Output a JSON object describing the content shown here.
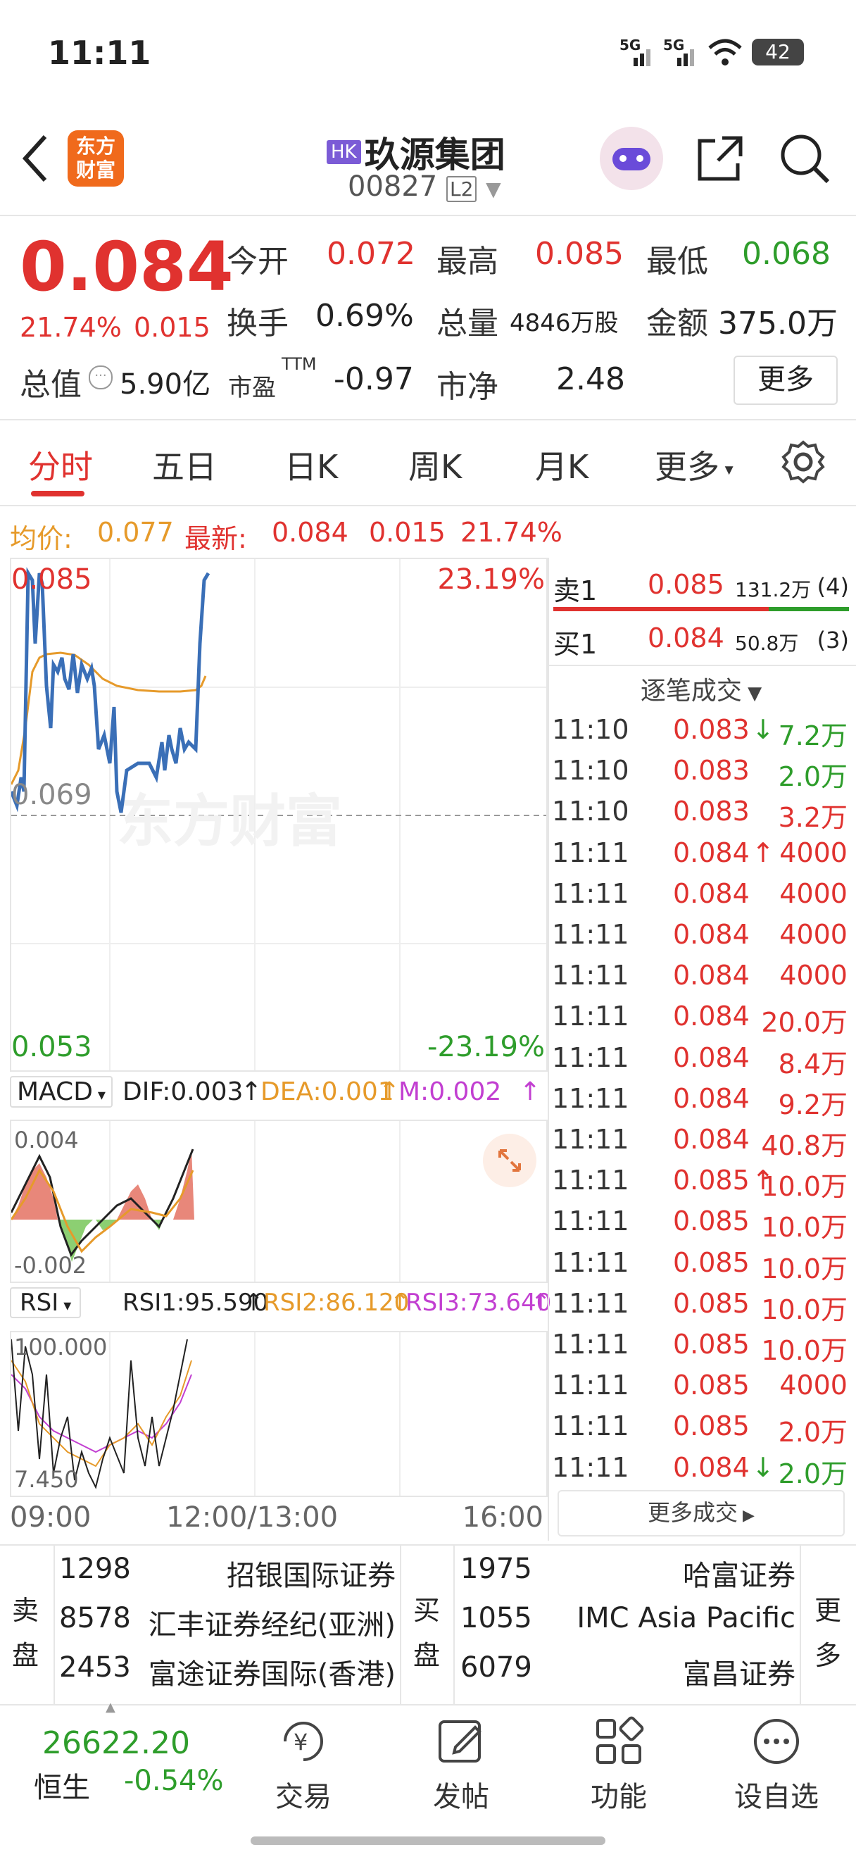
{
  "status_bar": {
    "time": "11:11",
    "signal1": "5G",
    "signal2": "5G",
    "battery": "42"
  },
  "header": {
    "back_icon": "chevron-left-icon",
    "app_logo_line1": "东方",
    "app_logo_line2": "财富",
    "market_badge": "HK",
    "stock_name": "玖源集团",
    "stock_code": "00827",
    "level_badge": "L2"
  },
  "quote": {
    "price": "0.084",
    "change_pct": "21.74%",
    "change_amt": "0.015",
    "open_label": "今开",
    "open": "0.072",
    "high_label": "最高",
    "high": "0.085",
    "low_label": "最低",
    "low": "0.068",
    "turnover_label": "换手",
    "turnover": "0.69%",
    "volume_label": "总量",
    "volume": "4846万股",
    "amount_label": "金额",
    "amount": "375.0万",
    "mktcap_label": "总值",
    "mktcap": "5.90亿",
    "pe_label": "市盈",
    "pe_sup": "TTM",
    "pe": "-0.97",
    "pb_label": "市净",
    "pb": "2.48",
    "more_button": "更多"
  },
  "tabs": [
    "分时",
    "五日",
    "日K",
    "周K",
    "月K",
    "更多"
  ],
  "avg_line": {
    "avg_label": "均价:",
    "avg": "0.077",
    "latest_label": "最新:",
    "latest": "0.084",
    "chg": "0.015",
    "pct": "21.74%"
  },
  "chart": {
    "y_top": "0.085",
    "y_mid": "0.069",
    "y_bottom": "0.053",
    "pct_top": "23.19%",
    "pct_bottom": "-23.19%",
    "watermark": "东方财富",
    "x_labels": [
      "09:00",
      "12:00/13:00",
      "16:00"
    ]
  },
  "macd": {
    "selector": "MACD",
    "dif": "DIF:0.003",
    "dea": "DEA:0.001",
    "m": "M:0.002",
    "top": "0.004",
    "bottom": "-0.002"
  },
  "rsi": {
    "selector": "RSI",
    "rsi1": "RSI1:95.590",
    "rsi2": "RSI2:86.120",
    "rsi3": "RSI3:73.640",
    "top": "100.000",
    "bottom": "7.450"
  },
  "order_book": {
    "sell_label": "卖1",
    "sell_price": "0.085",
    "sell_vol": "131.2万",
    "sell_count": "(4)",
    "buy_label": "买1",
    "buy_price": "0.084",
    "buy_vol": "50.8万",
    "buy_count": "(3)"
  },
  "ticks_title": "逐笔成交",
  "ticks": [
    {
      "time": "11:10",
      "price": "0.083",
      "arrow": "↓",
      "vol": "7.2万",
      "dir": "down"
    },
    {
      "time": "11:10",
      "price": "0.083",
      "arrow": "",
      "vol": "2.0万",
      "dir": "down"
    },
    {
      "time": "11:10",
      "price": "0.083",
      "arrow": "",
      "vol": "3.2万",
      "dir": "up"
    },
    {
      "time": "11:11",
      "price": "0.084",
      "arrow": "↑",
      "vol": "4000",
      "dir": "up"
    },
    {
      "time": "11:11",
      "price": "0.084",
      "arrow": "",
      "vol": "4000",
      "dir": "up"
    },
    {
      "time": "11:11",
      "price": "0.084",
      "arrow": "",
      "vol": "4000",
      "dir": "up"
    },
    {
      "time": "11:11",
      "price": "0.084",
      "arrow": "",
      "vol": "4000",
      "dir": "up"
    },
    {
      "time": "11:11",
      "price": "0.084",
      "arrow": "",
      "vol": "20.0万",
      "dir": "up"
    },
    {
      "time": "11:11",
      "price": "0.084",
      "arrow": "",
      "vol": "8.4万",
      "dir": "up"
    },
    {
      "time": "11:11",
      "price": "0.084",
      "arrow": "",
      "vol": "9.2万",
      "dir": "up"
    },
    {
      "time": "11:11",
      "price": "0.084",
      "arrow": "",
      "vol": "40.8万",
      "dir": "up"
    },
    {
      "time": "11:11",
      "price": "0.085",
      "arrow": "↑",
      "vol": "10.0万",
      "dir": "up"
    },
    {
      "time": "11:11",
      "price": "0.085",
      "arrow": "",
      "vol": "10.0万",
      "dir": "up"
    },
    {
      "time": "11:11",
      "price": "0.085",
      "arrow": "",
      "vol": "10.0万",
      "dir": "up"
    },
    {
      "time": "11:11",
      "price": "0.085",
      "arrow": "",
      "vol": "10.0万",
      "dir": "up"
    },
    {
      "time": "11:11",
      "price": "0.085",
      "arrow": "",
      "vol": "10.0万",
      "dir": "up"
    },
    {
      "time": "11:11",
      "price": "0.085",
      "arrow": "",
      "vol": "4000",
      "dir": "up"
    },
    {
      "time": "11:11",
      "price": "0.085",
      "arrow": "",
      "vol": "2.0万",
      "dir": "up"
    },
    {
      "time": "11:11",
      "price": "0.084",
      "arrow": "↓",
      "vol": "2.0万",
      "dir": "down"
    }
  ],
  "more_ticks": "更多成交",
  "brokers": {
    "sell_side_label": "卖盘",
    "sell": [
      {
        "code": "1298",
        "name": "招银国际证券"
      },
      {
        "code": "8578",
        "name": "汇丰证券经纪(亚洲)"
      },
      {
        "code": "2453",
        "name": "富途证券国际(香港)"
      }
    ],
    "buy_side_label": "买盘",
    "buy": [
      {
        "code": "1975",
        "name": "哈富证券"
      },
      {
        "code": "1055",
        "name": "IMC Asia Pacific"
      },
      {
        "code": "6079",
        "name": "富昌证券"
      }
    ],
    "more": "更多"
  },
  "bottom_nav": {
    "index_value": "26622.20",
    "index_name": "恒生",
    "index_change": "-0.54%",
    "items": [
      "交易",
      "发帖",
      "功能",
      "设自选"
    ]
  },
  "colors": {
    "up": "#e0322f",
    "down": "#2e9d2b",
    "avg": "#e69a2a",
    "price_line": "#3a6fb7",
    "accent": "#e0322f"
  }
}
